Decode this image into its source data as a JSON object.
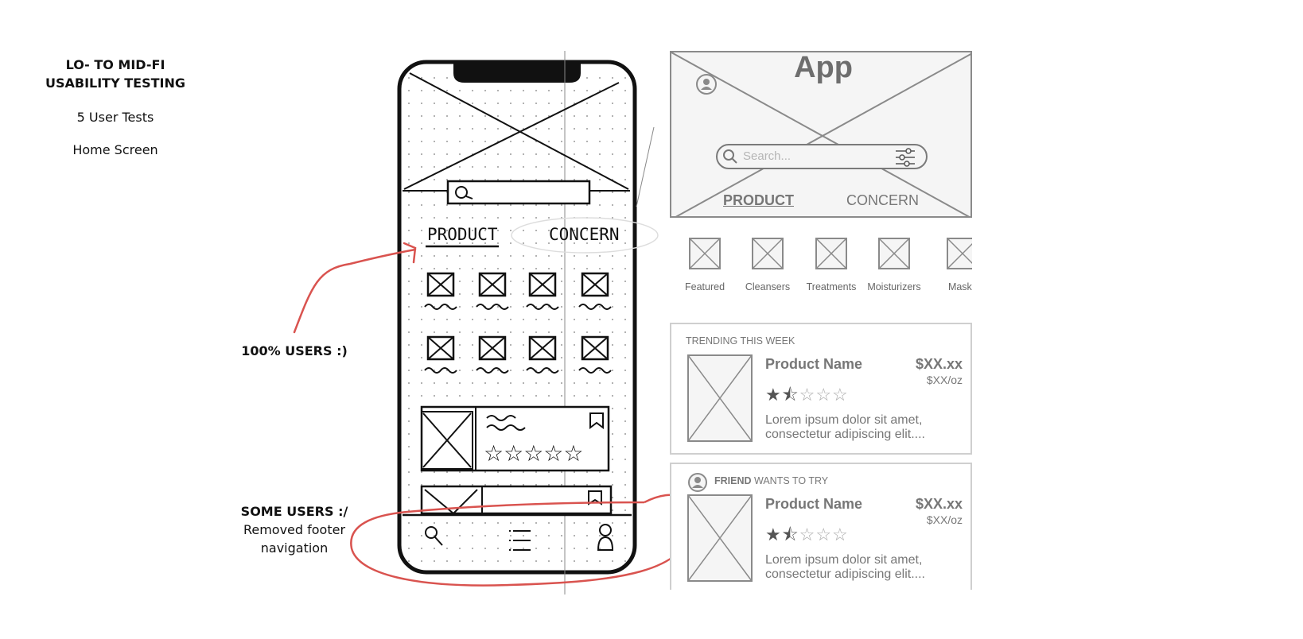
{
  "notes": {
    "title_line1": "LO- TO MID-FI",
    "title_line2": "USABILITY TESTING",
    "tests": "5 User Tests",
    "screen": "Home Screen"
  },
  "annotations": {
    "all_users": "100% USERS :)",
    "some_users": "SOME USERS :/",
    "some_users_note1": "Removed footer",
    "some_users_note2": "navigation"
  },
  "sketch": {
    "tab_product": "PRODUCT",
    "tab_concern": "CONCERN"
  },
  "wireframe": {
    "app_title": "App",
    "search_placeholder": "Search...",
    "tab_product": "PRODUCT",
    "tab_concern": "CONCERN",
    "categories": [
      "Featured",
      "Cleansers",
      "Treatments",
      "Moisturizers",
      "Masks"
    ],
    "card1": {
      "section": "TRENDING THIS WEEK",
      "product_name": "Product Name",
      "price": "$XX.xx",
      "unit_price": "$XX/oz",
      "rating": 1.5,
      "rating_max": 5,
      "desc_line1": "Lorem ipsum dolor sit amet,",
      "desc_line2": "consectetur adipiscing elit...."
    },
    "card2": {
      "friend_label": "FRIEND",
      "section_rest": "WANTS TO TRY",
      "product_name": "Product Name",
      "price": "$XX.xx",
      "unit_price": "$XX/oz",
      "rating": 1.5,
      "rating_max": 5,
      "desc_line1": "Lorem ipsum dolor sit amet,",
      "desc_line2": "consectetur adipiscing elit...."
    }
  },
  "colors": {
    "annotation_red": "#d9534f",
    "wireframe_gray": "#8a8a8a",
    "ink": "#111111"
  }
}
